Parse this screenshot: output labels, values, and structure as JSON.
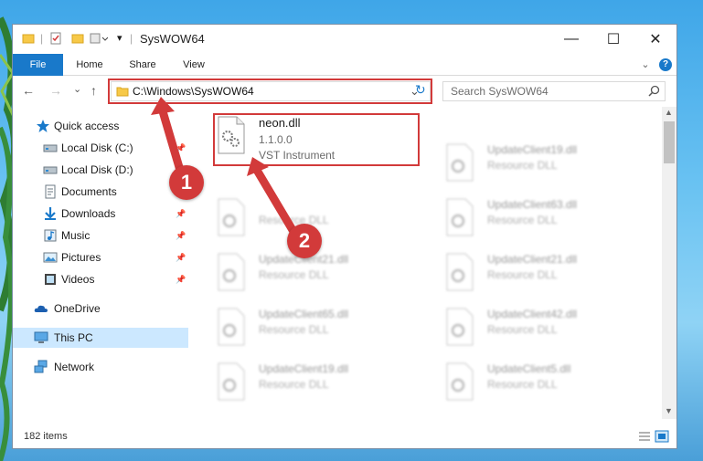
{
  "window": {
    "title": "SysWOW64",
    "minimize_glyph": "—",
    "maximize_glyph": "☐",
    "close_glyph": "✕"
  },
  "ribbon": {
    "tabs": [
      "File",
      "Home",
      "Share",
      "View"
    ],
    "collapse_glyph": "⌄",
    "help_glyph": "?"
  },
  "navigation": {
    "back_glyph": "←",
    "forward_glyph": "→",
    "recent_glyph": "⌄",
    "up_glyph": "↑"
  },
  "address_bar": {
    "path": "C:\\Windows\\SysWOW64",
    "dropdown_glyph": "⌄",
    "refresh_glyph": "↻"
  },
  "search": {
    "placeholder": "Search SysWOW64",
    "icon": "search-icon"
  },
  "nav_pane": {
    "items": [
      {
        "label": "Quick access",
        "icon": "star-icon"
      },
      {
        "label": "Local Disk (C:)",
        "icon": "drive-icon"
      },
      {
        "label": "Local Disk (D:)",
        "icon": "drive-icon"
      },
      {
        "label": "Documents",
        "icon": "documents-icon"
      },
      {
        "label": "Downloads",
        "icon": "downloads-icon"
      },
      {
        "label": "Music",
        "icon": "music-icon"
      },
      {
        "label": "Pictures",
        "icon": "pictures-icon"
      },
      {
        "label": "Videos",
        "icon": "videos-icon"
      },
      {
        "label": "OneDrive",
        "icon": "cloud-icon"
      },
      {
        "label": "This PC",
        "icon": "pc-icon"
      },
      {
        "label": "Network",
        "icon": "network-icon"
      }
    ],
    "pin_glyph": "📌"
  },
  "files": [
    {
      "name": "neon.dll",
      "line2": "1.1.0.0",
      "line3": "VST Instrument"
    },
    {
      "name": "UpdateClient19.dll",
      "line2": "Resource DLL"
    },
    {
      "name": "",
      "line2": "Resource DLL"
    },
    {
      "name": "UpdateClient63.dll",
      "line2": "Resource DLL"
    },
    {
      "name": "UpdateClient21.dll",
      "line2": "Resource DLL"
    },
    {
      "name": "UpdateClient21.dll",
      "line2": "Resource DLL"
    },
    {
      "name": "UpdateClient65.dll",
      "line2": "Resource DLL"
    },
    {
      "name": "UpdateClient42.dll",
      "line2": "Resource DLL"
    },
    {
      "name": "UpdateClient19.dll",
      "line2": "Resource DLL"
    },
    {
      "name": "UpdateClient5.dll",
      "line2": "Resource DLL"
    }
  ],
  "status": {
    "item_count": "182 items"
  },
  "callouts": [
    "1",
    "2"
  ],
  "colors": {
    "accent": "#1979ca",
    "highlight_red": "#d23a3a",
    "selected_nav": "#cce8ff"
  }
}
